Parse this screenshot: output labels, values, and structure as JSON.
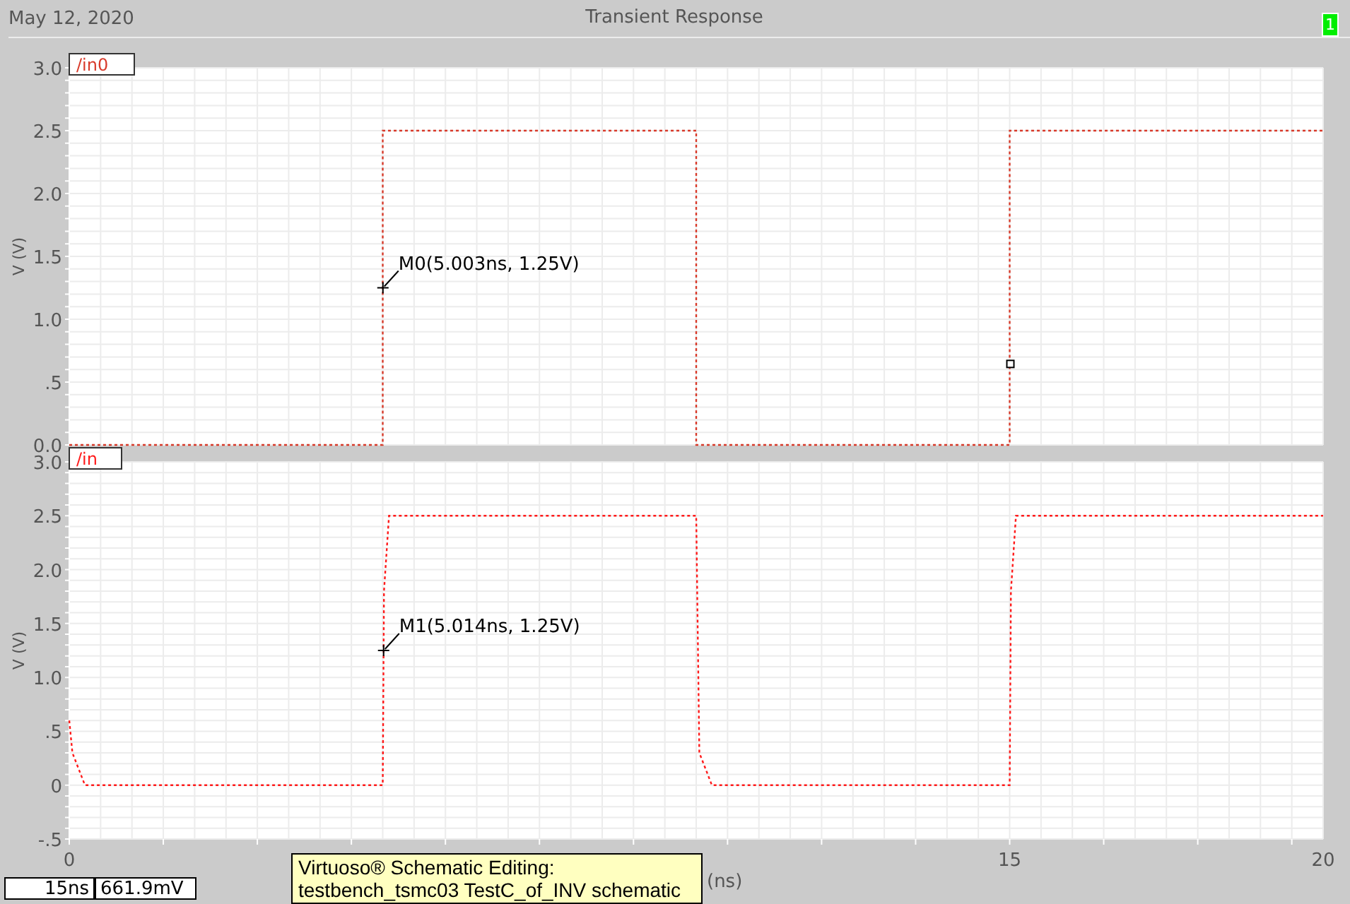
{
  "header": {
    "date": "May 12, 2020",
    "title": "Transient Response",
    "badge": "1"
  },
  "plots": [
    {
      "chart_data": {
        "type": "line",
        "grid": true,
        "ylabel": "V (V)",
        "xlim": [
          0,
          20
        ],
        "ylim": [
          0,
          3
        ],
        "x": [
          0,
          5,
          5,
          10,
          10,
          15,
          15,
          20
        ],
        "series": [
          {
            "name": "/in0",
            "color": "#d83a2a",
            "line_style": "dotted",
            "values": [
              0,
              0,
              2.5,
              2.5,
              0,
              0,
              2.5,
              2.5
            ]
          }
        ],
        "yticks": [
          {
            "value": 0,
            "label": "0.0"
          },
          {
            "value": 0.5,
            "label": ".5"
          },
          {
            "value": 1,
            "label": "1.0"
          },
          {
            "value": 1.5,
            "label": "1.5"
          },
          {
            "value": 2,
            "label": "2.0"
          },
          {
            "value": 2.5,
            "label": "2.5"
          },
          {
            "value": 3,
            "label": "3.0"
          }
        ],
        "annotations": [
          {
            "text": "M0(5.003ns, 1.25V)",
            "x": 5.003,
            "y": 1.25
          }
        ]
      }
    },
    {
      "chart_data": {
        "type": "line",
        "grid": true,
        "ylabel": "V (V)",
        "xlabel": "(ns)",
        "xlim": [
          0,
          20
        ],
        "ylim": [
          -0.5,
          3
        ],
        "x": [
          0,
          0.05,
          0.25,
          5,
          5.02,
          5.1,
          10,
          10.05,
          10.25,
          15,
          15.02,
          15.1,
          20
        ],
        "series": [
          {
            "name": "/in",
            "color": "#ff1a1a",
            "line_style": "dotted",
            "values": [
              0.6,
              0.3,
              0,
              0,
              1.8,
              2.5,
              2.5,
              0.3,
              0,
              0,
              1.8,
              2.5,
              2.5
            ]
          }
        ],
        "xticks": [
          0,
          15,
          20
        ],
        "yticks": [
          {
            "value": -0.5,
            "label": "-.5"
          },
          {
            "value": 0,
            "label": "0"
          },
          {
            "value": 0.5,
            "label": ".5"
          },
          {
            "value": 1,
            "label": "1.0"
          },
          {
            "value": 1.5,
            "label": "1.5"
          },
          {
            "value": 2,
            "label": "2.0"
          },
          {
            "value": 2.5,
            "label": "2.5"
          },
          {
            "value": 3,
            "label": "3.0"
          }
        ],
        "annotations": [
          {
            "text": "M1(5.014ns, 1.25V)",
            "x": 5.014,
            "y": 1.25
          }
        ]
      }
    }
  ],
  "readouts": [
    "15ns",
    "661.9mV"
  ],
  "tooltip": {
    "lines": [
      "Virtuoso® Schematic Editing:",
      "testbench_tsmc03 TestC_of_INV schematic"
    ]
  }
}
